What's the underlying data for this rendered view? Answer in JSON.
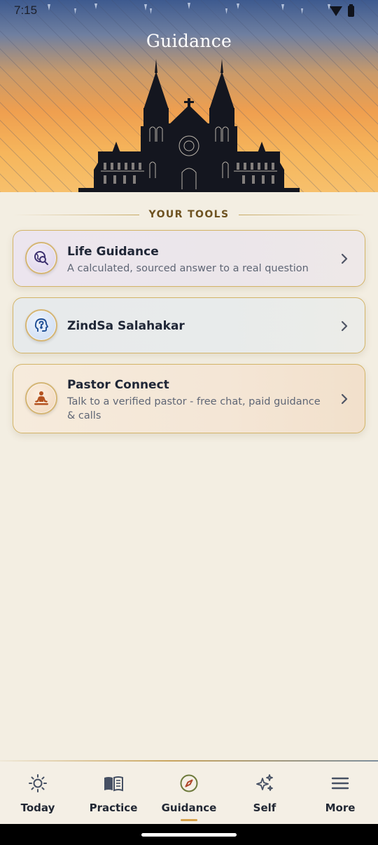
{
  "status_bar": {
    "time": "7:15",
    "icons": [
      "wifi-icon",
      "battery-icon"
    ]
  },
  "header": {
    "title": "Guidance",
    "illustration": "cathedral-silhouette"
  },
  "section": {
    "label": "YOUR TOOLS"
  },
  "tools": [
    {
      "title": "Life Guidance",
      "subtitle": "A calculated, sourced answer to a real question",
      "icon": "globe-search-icon",
      "accent": "#4a3c7a"
    },
    {
      "title": "ZindSa Salahakar",
      "subtitle": "",
      "icon": "head-question-icon",
      "accent": "#2f5fa8"
    },
    {
      "title": "Pastor Connect",
      "subtitle": "Talk to a verified pastor - free chat, paid guidance & calls",
      "icon": "meditating-person-icon",
      "accent": "#b4521f"
    }
  ],
  "bottom_nav": {
    "items": [
      {
        "label": "Today",
        "icon": "sun-icon"
      },
      {
        "label": "Practice",
        "icon": "book-icon"
      },
      {
        "label": "Guidance",
        "icon": "compass-icon",
        "active": true
      },
      {
        "label": "Self",
        "icon": "sparkles-icon"
      },
      {
        "label": "More",
        "icon": "menu-icon"
      }
    ]
  },
  "colors": {
    "background": "#f3eee2",
    "gold_border": "#d3b467",
    "nav_indicator": "#d7a24a",
    "text_primary": "#1f2636",
    "text_secondary": "#5f6675"
  }
}
